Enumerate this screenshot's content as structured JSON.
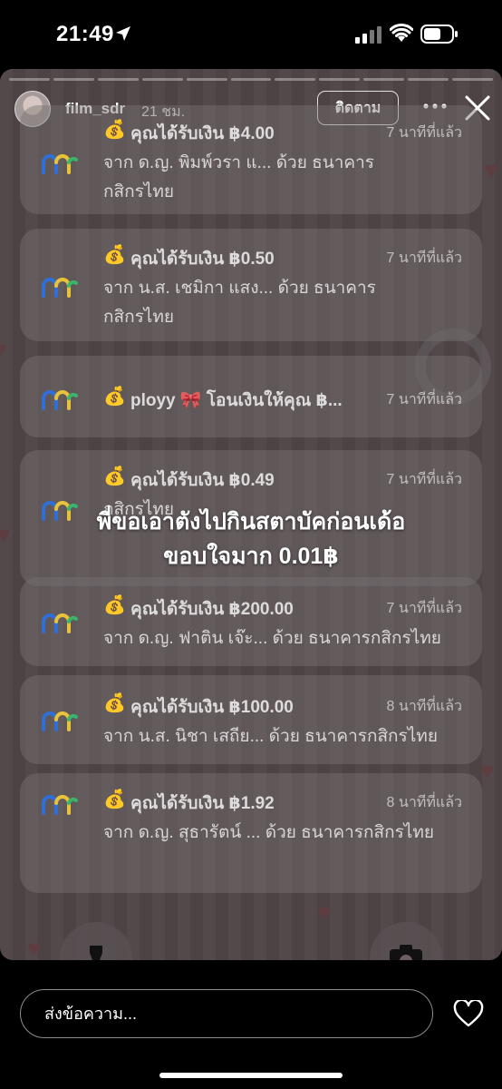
{
  "status_bar": {
    "time": "21:49"
  },
  "story": {
    "username": "film_sdr",
    "posted_ago": "21 ชม.",
    "follow_label": "ติดตาม",
    "progress_segments": 11,
    "progress_done": 0,
    "caption_line1": "พี่ขอเอาตังไปกินสตาบัคก่อนเด้อ",
    "caption_line2": "ขอบใจมาก 0.01฿",
    "notifications": [
      {
        "emoji": "💰",
        "title": "คุณได้รับเงิน ฿4.00",
        "time": "7 นาทีที่แล้ว",
        "line1": "จาก ด.ญ. พิมพ์วรา แ... ด้วย ธนาคาร",
        "line2": "กสิกรไทย"
      },
      {
        "emoji": "💰",
        "title": "คุณได้รับเงิน ฿0.50",
        "time": "7 นาทีที่แล้ว",
        "line1": "จาก น.ส. เชมิกา แสง... ด้วย ธนาคาร",
        "line2": "กสิกรไทย"
      },
      {
        "emoji": "💰",
        "title": "ployy 🎀 โอนเงินให้คุณ ฿...",
        "time": "7 นาทีที่แล้ว",
        "line1": "",
        "line2": ""
      },
      {
        "emoji": "💰",
        "title": "คุณได้รับเงิน ฿0.49",
        "time": "7 นาทีที่แล้ว",
        "line1": "",
        "line2": "กสิกรไทย"
      },
      {
        "emoji": "💰",
        "title": "คุณได้รับเงิน ฿200.00",
        "time": "7 นาทีที่แล้ว",
        "line1": "จาก ด.ญ. ฟาติน เจ๊ะ... ด้วย ธนาคารกสิกรไทย",
        "line2": ""
      },
      {
        "emoji": "💰",
        "title": "คุณได้รับเงิน ฿100.00",
        "time": "8 นาทีที่แล้ว",
        "line1": "จาก น.ส. นิชา เสถีย... ด้วย ธนาคารกสิกรไทย",
        "line2": ""
      },
      {
        "emoji": "💰",
        "title": "คุณได้รับเงิน ฿1.92",
        "time": "8 นาทีที่แล้ว",
        "line1": "จาก ด.ญ. สุธารัตน์ ... ด้วย ธนาคารกสิกรไทย",
        "line2": ""
      }
    ]
  },
  "bottom_bar": {
    "message_placeholder": "ส่งข้อความ..."
  },
  "colors": {
    "logo_blue": "#2f6fd6",
    "logo_yellow": "#e8c33a",
    "logo_green": "#3bb36a"
  },
  "icons": [
    "location-arrow-icon",
    "signal-icon",
    "wifi-icon",
    "battery-icon",
    "more-icon",
    "close-icon",
    "heart-icon",
    "flash-icon",
    "camera-icon",
    "bank-logo-icon"
  ]
}
